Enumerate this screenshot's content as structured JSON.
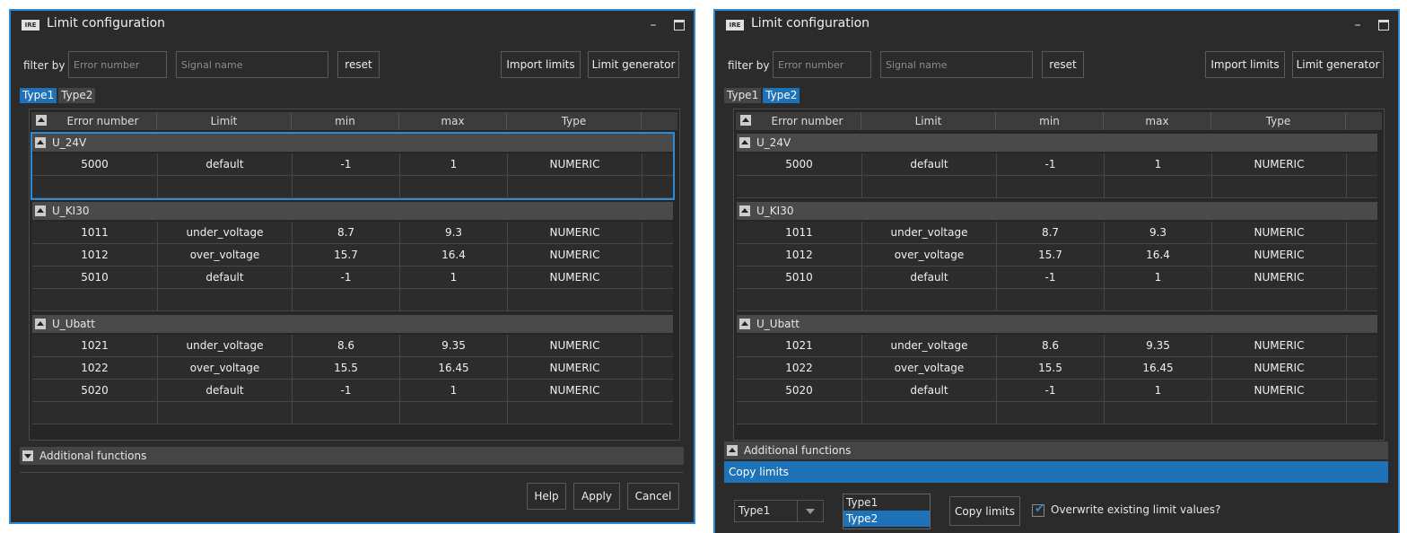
{
  "window_title": "Limit configuration",
  "filter_label": "filter by",
  "error_placeholder": "Error number",
  "signal_placeholder": "Signal name",
  "reset_label": "reset",
  "import_label": "Import limits",
  "generator_label": "Limit generator",
  "tabs": [
    "Type1",
    "Type2"
  ],
  "columns": [
    "Error number",
    "Limit",
    "min",
    "max",
    "Type"
  ],
  "groups": [
    {
      "name": "U_24V",
      "rows": [
        [
          "5000",
          "default",
          "-1",
          "1",
          "NUMERIC"
        ]
      ]
    },
    {
      "name": "U_KI30",
      "rows": [
        [
          "1011",
          "under_voltage",
          "8.7",
          "9.3",
          "NUMERIC"
        ],
        [
          "1012",
          "over_voltage",
          "15.7",
          "16.4",
          "NUMERIC"
        ],
        [
          "5010",
          "default",
          "-1",
          "1",
          "NUMERIC"
        ]
      ]
    },
    {
      "name": "U_Ubatt",
      "rows": [
        [
          "1021",
          "under_voltage",
          "8.6",
          "9.35",
          "NUMERIC"
        ],
        [
          "1022",
          "over_voltage",
          "15.5",
          "16.45",
          "NUMERIC"
        ],
        [
          "5020",
          "default",
          "-1",
          "1",
          "NUMERIC"
        ]
      ]
    }
  ],
  "additional_functions": "Additional functions",
  "help_label": "Help",
  "apply_label": "Apply",
  "cancel_label": "Cancel",
  "copy_limits_title": "Copy limits",
  "copy_source_value": "Type1",
  "copy_targets": [
    "Type1",
    "Type2"
  ],
  "copy_selected_target": "Type2",
  "copy_button_label": "Copy limits",
  "overwrite_label": "Overwrite existing limit values?",
  "overwrite_checked": true,
  "windows": [
    {
      "active_tab": "Type1",
      "additional_functions_expanded": false,
      "selected_group": "U_24V"
    },
    {
      "active_tab": "Type2",
      "additional_functions_expanded": true
    }
  ],
  "colors": {
    "accent": "#2d8ad4",
    "selection": "#1e72b8",
    "background": "#2b2b2b"
  },
  "icons": {
    "logo": "ire-logo",
    "minimize": "minimize-icon",
    "maximize": "maximize-icon",
    "collapse": "collapse-icon",
    "expand": "expand-icon",
    "dropdown": "chevron-down-icon",
    "check": "checkmark-icon"
  }
}
